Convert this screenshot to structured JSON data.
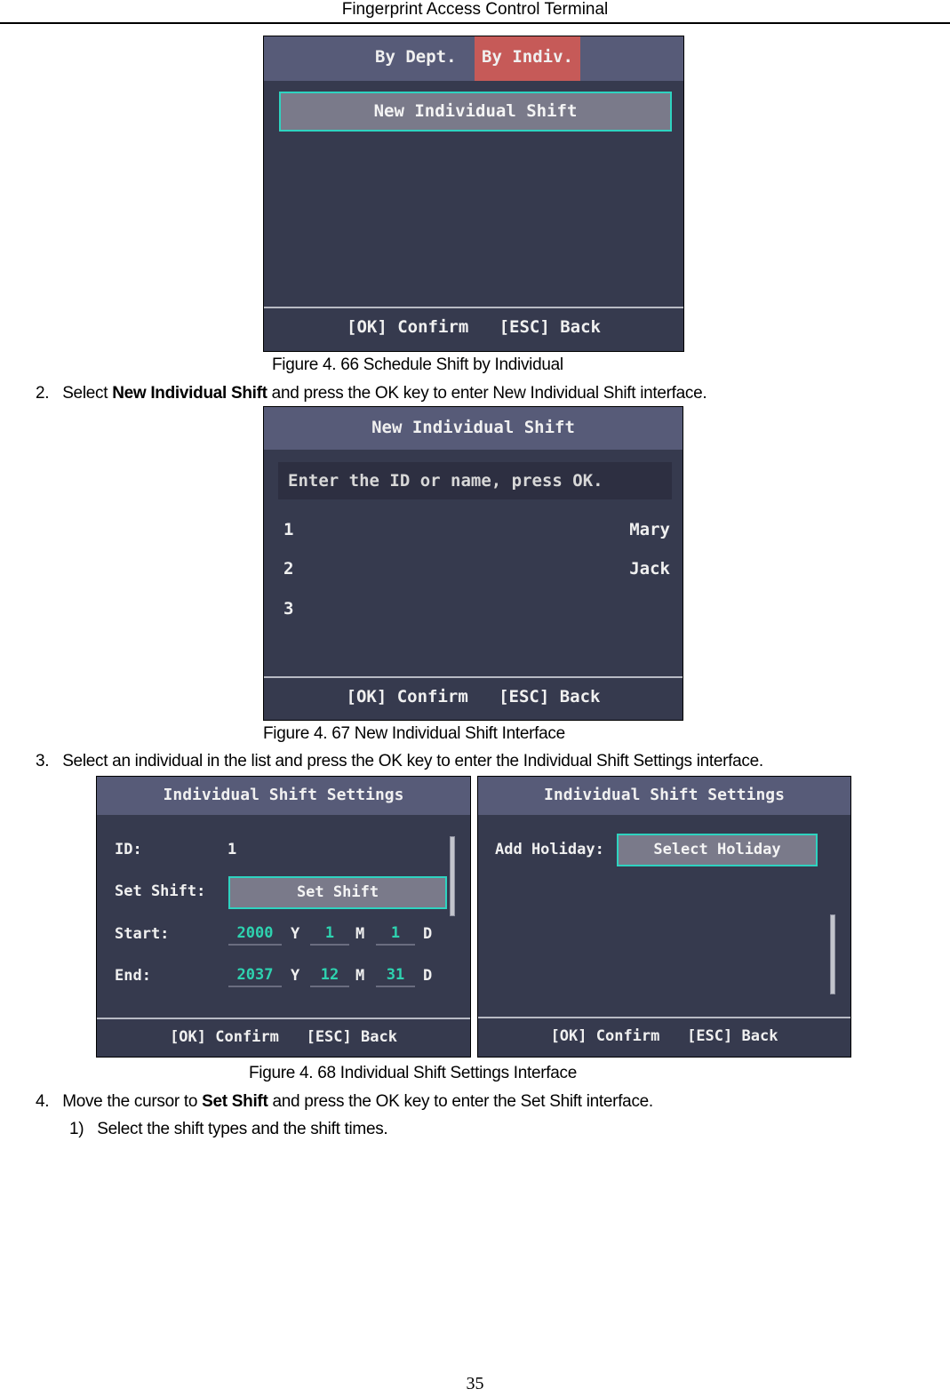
{
  "document": {
    "header": "Fingerprint Access Control Terminal",
    "page_number": "35"
  },
  "figure_66": {
    "tabs": [
      {
        "label": "By Dept.",
        "active": false
      },
      {
        "label": "By Indiv.",
        "active": true
      }
    ],
    "selected_item": "New Individual Shift",
    "footer": "[OK] Confirm   [ESC] Back",
    "caption": "Figure 4. 66 Schedule Shift by Individual"
  },
  "step_2": {
    "number": "2.",
    "prefix": "Select ",
    "bold": "New Individual Shift",
    "suffix": " and press the OK key to enter New Individual Shift interface."
  },
  "figure_67": {
    "title": "New Individual Shift",
    "search_placeholder": "Enter the ID or name, press OK.",
    "people": [
      {
        "id": "1",
        "name": "Mary"
      },
      {
        "id": "2",
        "name": "Jack"
      },
      {
        "id": "3",
        "name": ""
      }
    ],
    "footer": "[OK] Confirm   [ESC] Back",
    "caption": "Figure 4. 67 New Individual Shift Interface"
  },
  "step_3": {
    "number": "3.",
    "text": "Select an individual in the list and press the OK key to enter the Individual Shift Settings interface."
  },
  "figure_68": {
    "left": {
      "title": "Individual Shift Settings",
      "id_label": "ID:",
      "id_value": "1",
      "set_shift_label": "Set Shift:",
      "set_shift_button": "Set Shift",
      "start_label": "Start:",
      "start": {
        "year": "2000",
        "month": "1",
        "day": "1"
      },
      "end_label": "End:",
      "end": {
        "year": "2037",
        "month": "12",
        "day": "31"
      },
      "units": {
        "year": "Y",
        "month": "M",
        "day": "D"
      },
      "footer": "[OK] Confirm   [ESC] Back"
    },
    "right": {
      "title": "Individual Shift Settings",
      "add_holiday_label": "Add Holiday:",
      "select_holiday_button": "Select Holiday",
      "footer": "[OK] Confirm   [ESC] Back"
    },
    "caption": "Figure 4. 68 Individual Shift Settings Interface",
    "colors": {
      "highlight_border": "#2ed3c0",
      "value_text": "#2ed3b0",
      "active_tab": "#c65a58"
    }
  },
  "step_4": {
    "number": "4.",
    "prefix": "Move the cursor to ",
    "bold": "Set Shift",
    "suffix": " and press the OK key to enter the Set Shift interface."
  },
  "step_4_1": {
    "number": "1)",
    "text": "Select the shift types and the shift times."
  }
}
